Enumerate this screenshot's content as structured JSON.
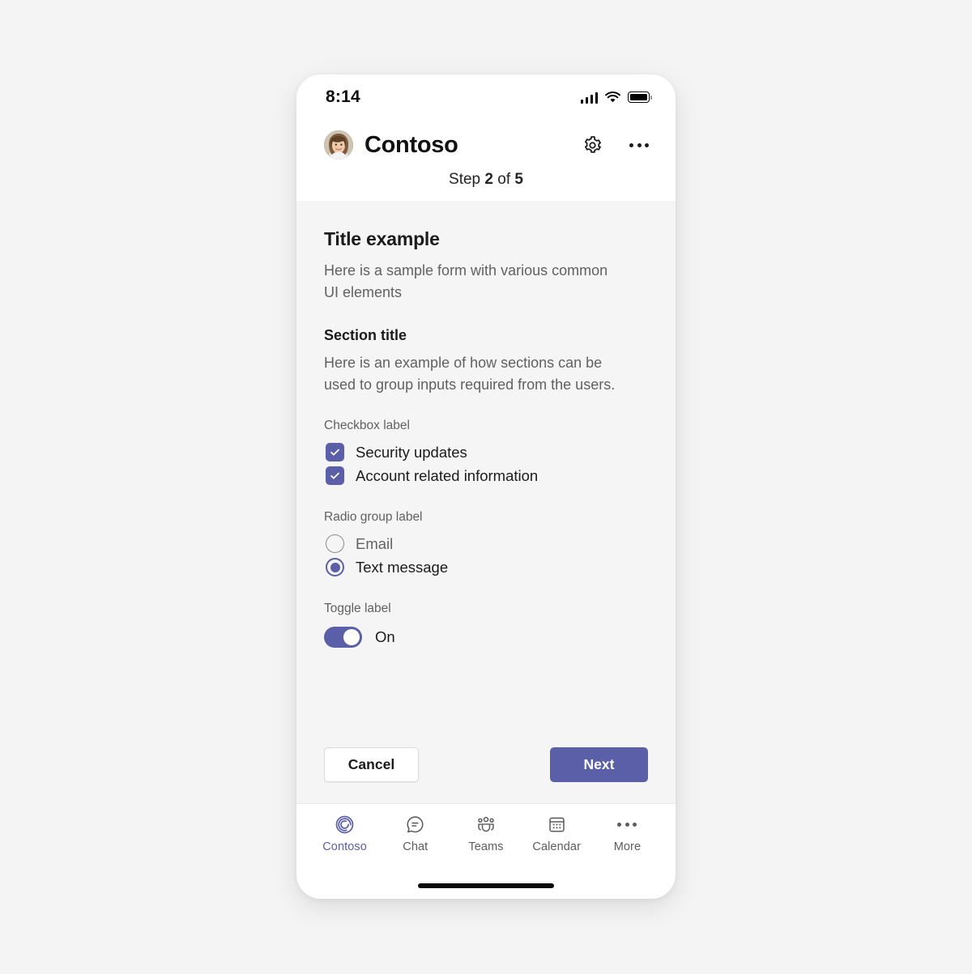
{
  "status_bar": {
    "time": "8:14",
    "signal_icon": "cellular-signal-icon",
    "wifi_icon": "wifi-icon",
    "battery_icon": "battery-icon"
  },
  "app_header": {
    "avatar_icon": "user-avatar",
    "title": "Contoso",
    "settings_icon": "gear-icon",
    "overflow_icon": "ellipsis-icon"
  },
  "step_indicator": {
    "prefix": "Step",
    "current": "2",
    "middle": "of",
    "total": "5"
  },
  "content": {
    "title": "Title example",
    "description": "Here is a sample form with various common UI elements",
    "section_title": "Section title",
    "section_description": "Here is an example of how sections can be used to group inputs required from the users.",
    "checkbox_group": {
      "label": "Checkbox label",
      "options": [
        {
          "label": "Security updates",
          "checked": true
        },
        {
          "label": "Account related information",
          "checked": true
        }
      ]
    },
    "radio_group": {
      "label": "Radio group label",
      "options": [
        {
          "label": "Email",
          "selected": false
        },
        {
          "label": "Text message",
          "selected": true
        }
      ]
    },
    "toggle": {
      "label": "Toggle label",
      "state_text": "On",
      "on": true
    }
  },
  "footer": {
    "cancel_label": "Cancel",
    "next_label": "Next"
  },
  "bottom_nav": {
    "items": [
      {
        "label": "Contoso",
        "icon": "contoso-spiral-icon",
        "active": true
      },
      {
        "label": "Chat",
        "icon": "chat-bubble-icon",
        "active": false
      },
      {
        "label": "Teams",
        "icon": "teams-people-icon",
        "active": false
      },
      {
        "label": "Calendar",
        "icon": "calendar-icon",
        "active": false
      },
      {
        "label": "More",
        "icon": "ellipsis-icon",
        "active": false
      }
    ]
  },
  "colors": {
    "accent": "#5B5FA8",
    "page_background": "#F4F4F4",
    "content_background": "#F5F5F5",
    "surface": "#FFFFFF",
    "text_primary": "#1B1B1B",
    "text_secondary": "#616161"
  }
}
